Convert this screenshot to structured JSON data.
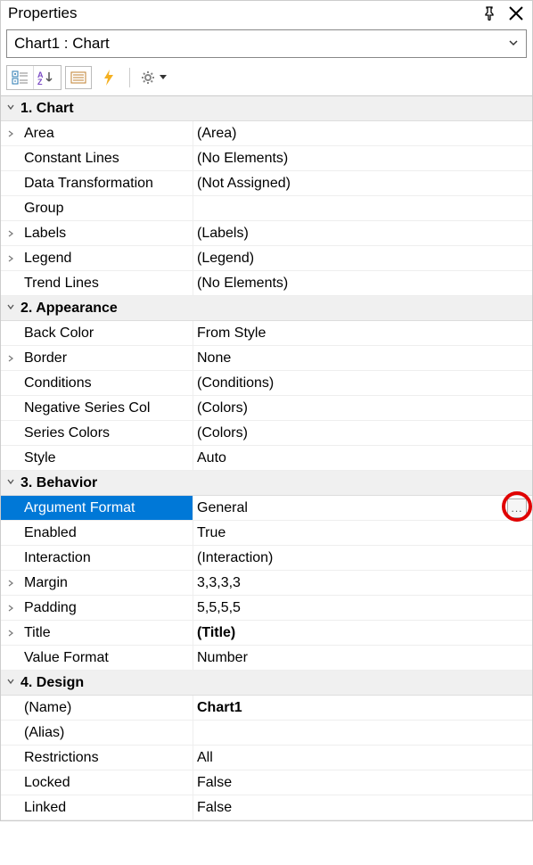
{
  "title": "Properties",
  "selector": "Chart1 : Chart",
  "categories": [
    {
      "label": "1. Chart",
      "rows": [
        {
          "exp": true,
          "name": "Area",
          "value": "(Area)"
        },
        {
          "exp": false,
          "name": "Constant Lines",
          "value": "(No Elements)"
        },
        {
          "exp": false,
          "name": "Data Transformation",
          "value": "(Not Assigned)"
        },
        {
          "exp": false,
          "name": "Group",
          "value": ""
        },
        {
          "exp": true,
          "name": "Labels",
          "value": "(Labels)"
        },
        {
          "exp": true,
          "name": "Legend",
          "value": "(Legend)"
        },
        {
          "exp": false,
          "name": "Trend Lines",
          "value": "(No Elements)"
        }
      ]
    },
    {
      "label": "2. Appearance",
      "rows": [
        {
          "exp": false,
          "name": "Back Color",
          "value": "From Style"
        },
        {
          "exp": true,
          "name": "Border",
          "value": "None"
        },
        {
          "exp": false,
          "name": "Conditions",
          "value": "(Conditions)"
        },
        {
          "exp": false,
          "name": "Negative Series Col",
          "value": "(Colors)"
        },
        {
          "exp": false,
          "name": "Series Colors",
          "value": "(Colors)"
        },
        {
          "exp": false,
          "name": "Style",
          "value": "Auto"
        }
      ]
    },
    {
      "label": "3. Behavior",
      "rows": [
        {
          "exp": false,
          "name": "Argument Format",
          "value": "General",
          "selected": true,
          "ellipsis": true
        },
        {
          "exp": false,
          "name": "Enabled",
          "value": "True"
        },
        {
          "exp": false,
          "name": "Interaction",
          "value": "(Interaction)"
        },
        {
          "exp": true,
          "name": "Margin",
          "value": "3,3,3,3"
        },
        {
          "exp": true,
          "name": "Padding",
          "value": "5,5,5,5"
        },
        {
          "exp": true,
          "name": "Title",
          "value": "(Title)",
          "bold": true
        },
        {
          "exp": false,
          "name": "Value Format",
          "value": "Number"
        }
      ]
    },
    {
      "label": "4. Design",
      "rows": [
        {
          "exp": false,
          "name": "(Name)",
          "value": "Chart1",
          "bold": true
        },
        {
          "exp": false,
          "name": "(Alias)",
          "value": ""
        },
        {
          "exp": false,
          "name": "Restrictions",
          "value": "All"
        },
        {
          "exp": false,
          "name": "Locked",
          "value": "False"
        },
        {
          "exp": false,
          "name": "Linked",
          "value": "False"
        }
      ]
    }
  ]
}
